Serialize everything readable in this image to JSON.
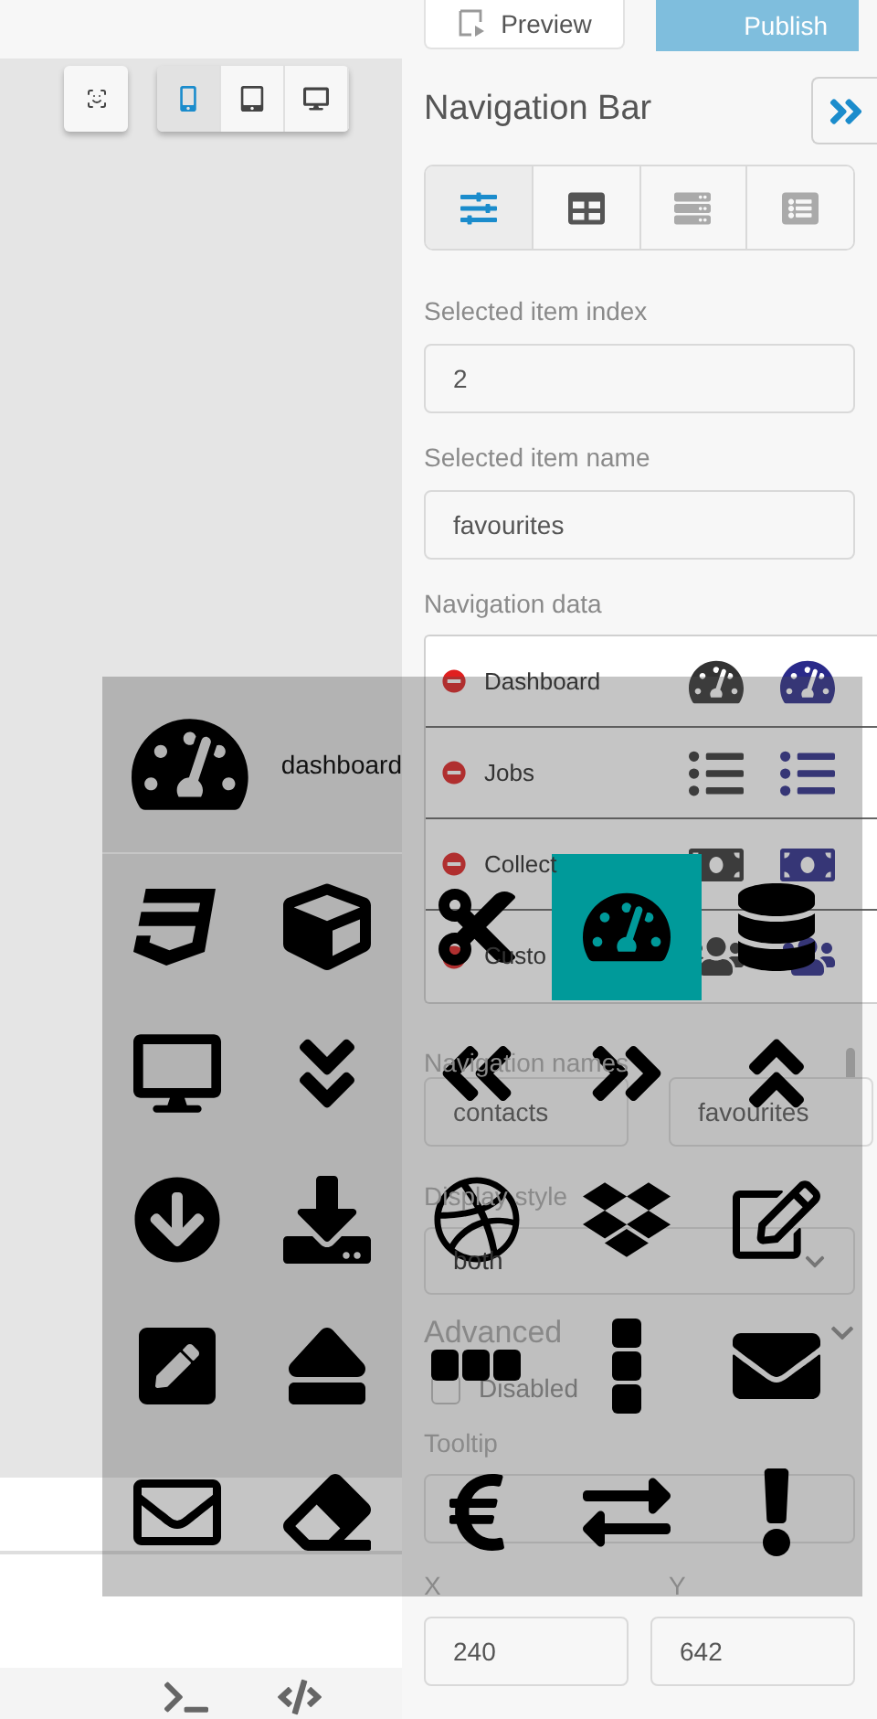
{
  "top_bar": {
    "preview": "Preview",
    "publish": "Publish"
  },
  "device_toolbar": [
    {
      "selected": true
    },
    {
      "selected": false
    },
    {
      "selected": false
    }
  ],
  "panel": {
    "title": "Navigation Bar",
    "tabs": [
      {
        "selected": true
      },
      {
        "selected": false
      },
      {
        "selected": false
      },
      {
        "selected": false
      }
    ],
    "selected_index": {
      "label": "Selected item index",
      "value": "2"
    },
    "selected_name": {
      "label": "Selected item name",
      "value": "favourites"
    },
    "navigation_data": {
      "label": "Navigation data",
      "rows": [
        {
          "name": "Dashboard"
        },
        {
          "name": "Jobs"
        },
        {
          "name": "Collect"
        },
        {
          "name": "Custo"
        }
      ]
    },
    "navigation_names": {
      "label": "Navigation names",
      "values": [
        "contacts",
        "favourites"
      ]
    },
    "display_style": {
      "label": "Display style",
      "value": "both"
    },
    "advanced": {
      "label": "Advanced",
      "disabled": {
        "label": "Disabled",
        "checked": false
      }
    },
    "tooltip": {
      "label": "Tooltip"
    },
    "x": {
      "label": "X",
      "value": "240"
    },
    "y": {
      "label": "Y",
      "value": "642"
    }
  },
  "icon_picker": {
    "current": "dashboard",
    "cells": [
      {
        "selected": false
      },
      {
        "selected": false
      },
      {
        "selected": false
      },
      {
        "selected": true
      },
      {
        "selected": false
      },
      {
        "selected": false
      },
      {
        "selected": false
      },
      {
        "selected": false
      },
      {
        "selected": false
      },
      {
        "selected": false
      },
      {
        "selected": false
      },
      {
        "selected": false
      },
      {
        "selected": false
      },
      {
        "selected": false
      },
      {
        "selected": false
      },
      {
        "selected": false
      },
      {
        "selected": false
      },
      {
        "selected": false
      },
      {
        "selected": false
      },
      {
        "selected": false
      },
      {
        "selected": false
      },
      {
        "selected": false
      },
      {
        "selected": false
      },
      {
        "selected": false
      },
      {
        "selected": false
      }
    ]
  }
}
